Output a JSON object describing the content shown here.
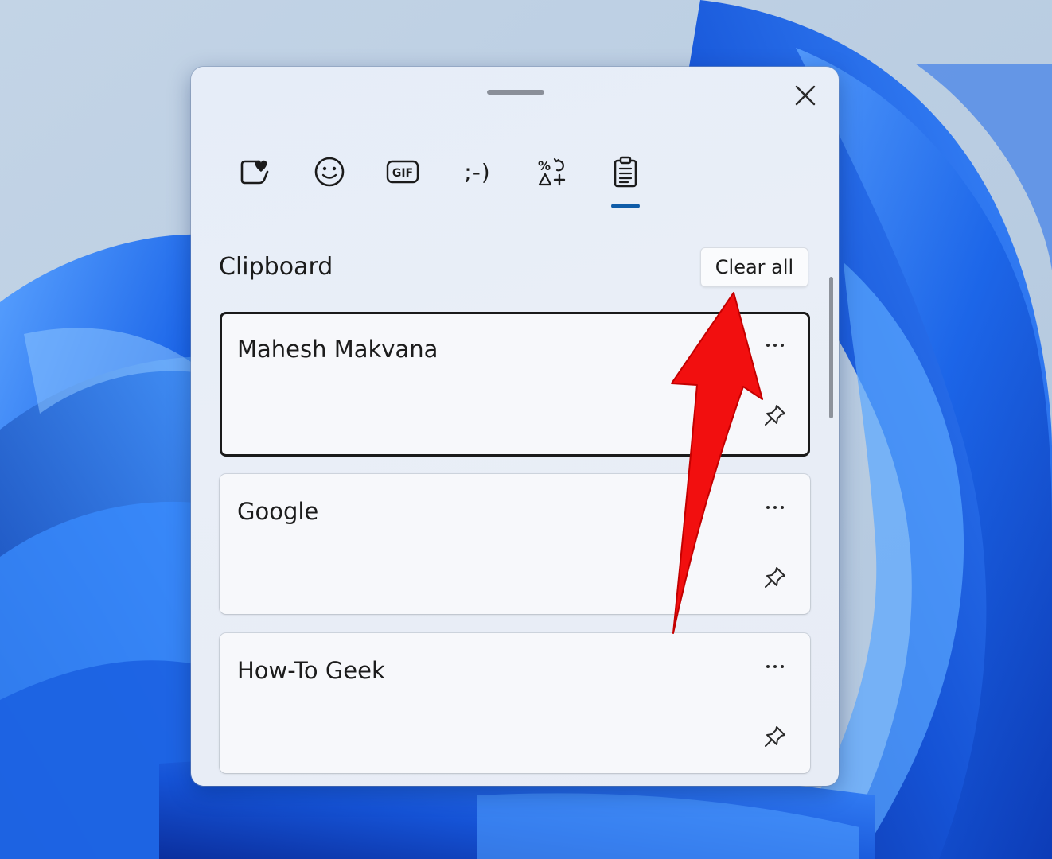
{
  "panel": {
    "tabs": [
      {
        "name": "kaomoji-favorites",
        "icon": "heart-sticker-icon"
      },
      {
        "name": "emoji",
        "icon": "smiley-face-icon"
      },
      {
        "name": "gif",
        "icon": "gif-icon",
        "label": "GIF"
      },
      {
        "name": "kaomoji",
        "icon": "kaomoji-icon",
        "label": ";-)"
      },
      {
        "name": "symbols",
        "icon": "symbols-icon"
      },
      {
        "name": "clipboard",
        "icon": "clipboard-icon",
        "selected": true
      }
    ],
    "section_title": "Clipboard",
    "clear_all_label": "Clear all",
    "items": [
      {
        "text": "Mahesh Makvana",
        "selected": true
      },
      {
        "text": "Google",
        "selected": false
      },
      {
        "text": "How-To Geek",
        "selected": false
      }
    ]
  },
  "colors": {
    "accent": "#0f5ca8",
    "annotation_arrow": "#f20f0f",
    "wallpaper_base": "#b9cde2",
    "wallpaper_bloom": "#1a64e8"
  }
}
